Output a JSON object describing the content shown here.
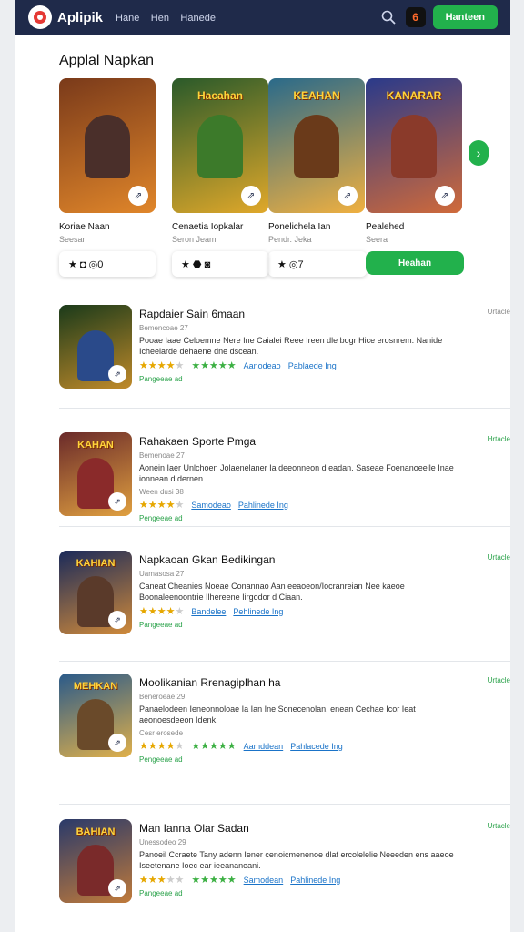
{
  "header": {
    "brand": "Aplipik",
    "nav": [
      "Hane",
      "Hen",
      "Hanede"
    ],
    "cta": "Hanteen",
    "badge": "6",
    "icons": {
      "search": "search-icon",
      "badge": "app-badge-icon"
    }
  },
  "title": "Applal Napkan",
  "featured": [
    {
      "name": "Koriae Naan",
      "sub": "Seesan",
      "bar": "★ ◘ ◎0",
      "art_title": "",
      "c1": "#7a3a1a",
      "c2": "#e0862a",
      "fig": "#4a2f2a"
    },
    {
      "name": "Cenaetia Iopkalar",
      "sub": "Seron Jeam",
      "bar": "★ ⬣ ◙",
      "art_title": "Hacahan",
      "c1": "#2a5a2a",
      "c2": "#e0a82a",
      "fig": "#3c7a2a"
    },
    {
      "name": "Ponelichela Ian",
      "sub": "Pendr. Jeka",
      "bar": "★ ◎7",
      "art_title": "KEAHAN",
      "c1": "#2a6a8a",
      "c2": "#f0b040",
      "fig": "#6a3a1a"
    },
    {
      "name": "Pealehed",
      "sub": "Seera",
      "install": "Heahan",
      "art_title": "KANARAR",
      "c1": "#2a3a8a",
      "c2": "#d06a3a",
      "fig": "#8a3a2a"
    }
  ],
  "list": [
    {
      "name": "Rapdaier Sain 6maan",
      "meta": "Bemencoae 27",
      "desc": "Pooae Iaae Celoemne Nere Ine Caialei Reee Ireen dle bogr Hice erosnrem. Nanide Icheelarde dehaene dne dscean.",
      "link1": "Aanodeao",
      "link2": "Pablaede Ing",
      "bottom": "Pangeeae ad",
      "tag": "Urtacle",
      "tag_grey": true,
      "stars1": 4,
      "stars2": 5,
      "art_title": "",
      "c1": "#1a3a1a",
      "c2": "#c08a2a",
      "fig": "#2a4a8a"
    },
    {
      "name": "Rahakaen Sporte Pmga",
      "meta": "Bemenoae 27",
      "desc": "Aonein Iaer Unlchoen Jolaenelaner Ia deeonneon d eadan. Saseae Foenanoeelle Inae ionnean d dernen.",
      "extra": "Ween dusi 38",
      "link1": "Samodeao",
      "link2": "Pahlinede Ing",
      "bottom": "Pengeeae ad",
      "tag": "Hrtacle",
      "stars1": 4,
      "stars2": 0,
      "art_title": "KAHAN",
      "c1": "#6a2a2a",
      "c2": "#e0a040",
      "fig": "#8a2a2a"
    },
    {
      "name": "Napkaoan Gkan Bedikingan",
      "meta": "Uamasosa 27",
      "desc": "Caneat Cheanies Noeae Conannao Aan eeaoeon/Iocranreian Nee kaeoe Boonaleenoontrie Ilhereene Iirgodor d Ciaan.",
      "link1": "Bandelee",
      "link2": "Pehlinede Ing",
      "bottom": "Pangeeae ad",
      "tag": "Urtacle",
      "stars1": 4,
      "stars2": 0,
      "art_title": "KAHIAN",
      "c1": "#1a2a5a",
      "c2": "#d08a3a",
      "fig": "#5a3a2a"
    },
    {
      "name": "Moolikanian Rrenagiplhan ha",
      "meta": "Beneroeae 29",
      "desc": "Panaelodeen Ieneonnoloae Ia Ian Ine Sonecenolan. enean Cechae Icor Ieat aeonoesdeeon Idenk.",
      "extra": "Cesr erosede",
      "link1": "Aamddean",
      "link2": "Pahlacede Ing",
      "bottom": "Pengeeae ad",
      "tag": "Urtacle",
      "stars1": 4,
      "stars2": 5,
      "art_title": "MEHKAN",
      "c1": "#2a5a8a",
      "c2": "#e0b04a",
      "fig": "#6a4a2a"
    },
    {
      "name": "Man Ianna Olar Sadan",
      "meta": "Unessodeo 29",
      "desc": "Panoeil Ccraete Tany adenn Iener cenoicmenenoe dlaf ercolelelie Neeeden ens aaeoe Iseetenane Ioec ear ieeananeani.",
      "link1": "Samodean",
      "link2": "Pahlinede Ing",
      "bottom": "Pangeeae ad",
      "tag": "Urtacle",
      "stars1": 3,
      "stars2": 5,
      "art_title": "BAHIAN",
      "c1": "#2a3a6a",
      "c2": "#c07a3a",
      "fig": "#7a2a2a"
    }
  ]
}
